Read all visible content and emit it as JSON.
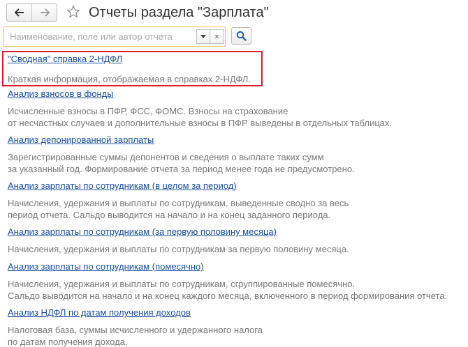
{
  "header": {
    "back_icon": "arrow-left-icon",
    "forward_icon": "arrow-right-icon",
    "favorite_icon": "star-outline-icon",
    "title": "Отчеты раздела \"Зарплата\""
  },
  "search": {
    "placeholder": "Наименование, поле или автор отчета",
    "value": "",
    "dropdown_icon": "triangle-down-icon",
    "clear_label": "×",
    "search_icon": "magnifier-icon"
  },
  "reports": [
    {
      "title": "\"Сводная\" справка 2-НДФЛ",
      "desc": [
        "Краткая информация, отображаемая в справках 2-НДФЛ."
      ],
      "highlighted": true
    },
    {
      "title": "Анализ взносов в фонды",
      "desc": [
        "Исчисленные взносы в ПФР, ФСС, ФОМС. Взносы на страхование",
        "от несчастных случаев и дополнительные взносы в ПФР выведены в отдельных таблицах."
      ]
    },
    {
      "title": "Анализ депонированной зарплаты",
      "desc": [
        "Зарегистрированные суммы депонентов и сведения о выплате таких сумм",
        "за указанный год. Формирование отчета за период менее года не предусмотрено."
      ]
    },
    {
      "title": "Анализ зарплаты по сотрудникам (в целом за период)",
      "desc": [
        "Начисления, удержания и выплаты по сотрудникам, выведенные сводно за весь",
        "период отчета. Сальдо выводится на начало и на конец заданного периода."
      ]
    },
    {
      "title": "Анализ зарплаты по сотрудникам (за первую половину месяца)",
      "desc": [
        "Начисления, удержания и выплаты по сотрудникам за первую половину месяца."
      ]
    },
    {
      "title": "Анализ зарплаты по сотрудникам (помесячно)",
      "desc": [
        "Начисления, удержания и выплаты по сотрудникам, сгруппированные помесячно.",
        "Сальдо выводится на начало и на конец каждого месяца, включенного в период формирования отчета."
      ]
    },
    {
      "title": "Анализ НДФЛ по датам получения доходов",
      "desc": [
        "Налоговая база, суммы исчисленного и удержанного налога",
        "по датам получения дохода."
      ]
    }
  ],
  "colors": {
    "link": "#1a4ea0",
    "description": "#777777",
    "highlight": "#e0192b",
    "search_focus": "#f2c14e"
  }
}
